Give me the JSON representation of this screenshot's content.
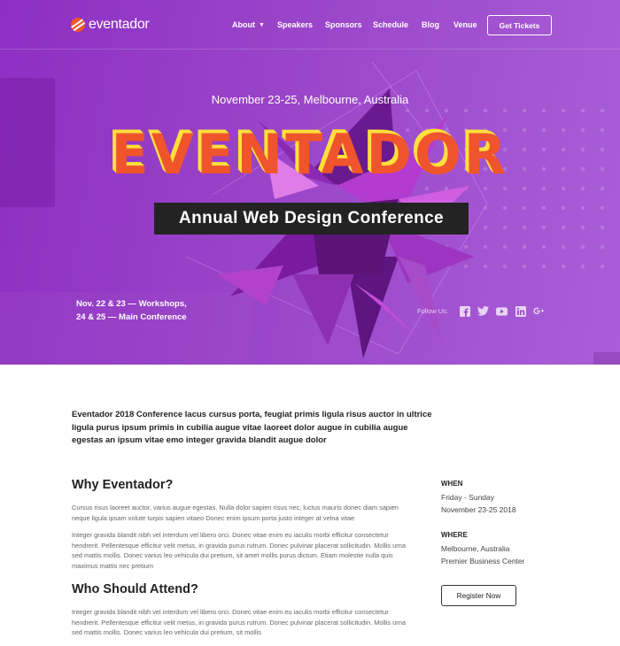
{
  "brand": {
    "name": "eventador",
    "accent": "#f0542d",
    "hero_gradient": [
      "#8d2fc3",
      "#a95fd8"
    ]
  },
  "nav": {
    "items": [
      {
        "label": "About",
        "has_dropdown": true
      },
      {
        "label": "Speakers"
      },
      {
        "label": "Sponsors"
      },
      {
        "label": "Schedule"
      },
      {
        "label": "Blog"
      },
      {
        "label": "Venue"
      }
    ],
    "cta": "Get Tickets"
  },
  "hero": {
    "date_location": "November 23-25, Melbourne, Australia",
    "title": "EVENTADOR",
    "subtitle": "Annual Web Design Conference",
    "dates_line1": "Nov. 22 & 23 — Workshops,",
    "dates_line2": "24 & 25 — Main Conference",
    "follow_label": "Follow Us:",
    "social_icons": [
      "facebook-icon",
      "twitter-icon",
      "youtube-icon",
      "linkedin-icon",
      "google-plus-icon"
    ]
  },
  "content": {
    "intro": "Eventador 2018 Conference lacus cursus porta, feugiat primis ligula risus auctor in ultrice ligula purus ipsum primis in cubilia augue vitae laoreet dolor augue in cubilia augue egestas an ipsum vitae emo integer gravida blandit augue dolor",
    "why_title": "Why Eventador?",
    "why_p1": "Cursus risus laoreet auctor, varius augue egestas. Nulla dolor sapien risus nec, luctus mauris donec diam sapien neque ligula ipsam volute turpis sapien vitaeo Donec enim ipsum porta justo integer at velna vitae",
    "why_p2": "Integer gravida blandit nibh vel interdum vel libero orci. Donec vitae enim eu iaculis morbi efficitur consectetur hendrerit. Pellentesque efficitur velit metus, in gravida purus rutrum. Donec pulvinar placerat sollicitudin. Mollis urna sed mattis mollis. Donec varius leo vehicula dui pretium, sit amet mollis purus dictum. Etiam molestie nulla quis maximus mattis nec pretium",
    "who_title": "Who Should Attend?",
    "who_p1": "Integer gravida blandit nibh vel interdum vel libero orci. Donec vitae enim eu iaculis morbi efficitur consectetur hendrerit. Pellentesque efficitur velit metus, in gravida purus rutrum. Donec pulvinar placerat sollicitudin. Mollis urna sed mattis mollis. Donec varius leo vehicula dui pretium, sit mollis"
  },
  "sidebar": {
    "when_label": "WHEN",
    "when_line1": "Friday - Sunday",
    "when_line2": "November 23-25 2018",
    "where_label": "WHERE",
    "where_line1": "Melbourne, Australia",
    "where_line2": "Premier Business Center",
    "register": "Register Now"
  }
}
